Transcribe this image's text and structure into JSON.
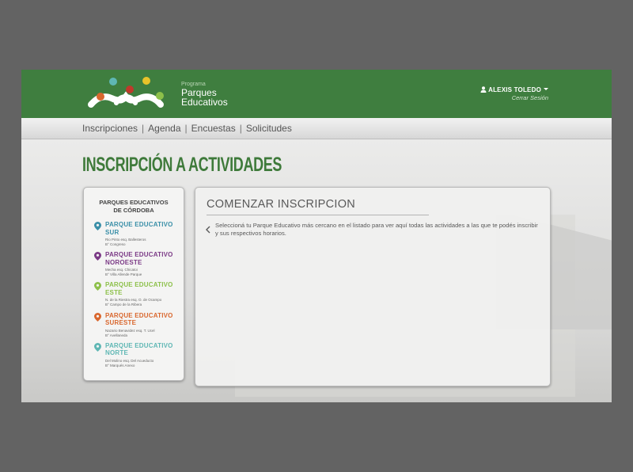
{
  "brand": {
    "small": "Programa",
    "line1": "Parques",
    "line2": "Educativos"
  },
  "user": {
    "name": "ALEXIS TOLEDO",
    "logout": "Cerrar Sesión"
  },
  "nav": {
    "items": [
      "Inscripciones",
      "Agenda",
      "Encuestas",
      "Solicitudes"
    ],
    "separator": "|"
  },
  "page_title": "INSCRIPCIÓN A ACTIVIDADES",
  "sidebar": {
    "title_line1": "PARQUES EDUCATIVOS",
    "title_line2": "DE CÓRDOBA",
    "parks": [
      {
        "name1": "PARQUE EDUCATIVO",
        "name2": "SUR",
        "addr1": "Rio Pinto esq. Ballesteros",
        "addr2": "B° Congreso",
        "color": "#3a8fa8"
      },
      {
        "name1": "PARQUE EDUCATIVO",
        "name2": "NOROESTE",
        "addr1": "Mecha esq. Chicatoi",
        "addr2": "B° Villa Allende Parque",
        "color": "#7b3a86"
      },
      {
        "name1": "PARQUE EDUCATIVO",
        "name2": "ESTE",
        "addr1": "N. de la Riestra esq. O. de Ocampo",
        "addr2": "B° Campo de la Ribera",
        "color": "#8dc04a"
      },
      {
        "name1": "PARQUE EDUCATIVO",
        "name2": "SURESTE",
        "addr1": "Nazario Benavidez esq. T. Ucel",
        "addr2": "B° Avellaneda",
        "color": "#d9672e"
      },
      {
        "name1": "PARQUE EDUCATIVO",
        "name2": "NORTE",
        "addr1": "Del Molino esq. Del Acueducto",
        "addr2": "B° Marqués Anexo",
        "color": "#5fb7b4"
      }
    ]
  },
  "panel": {
    "title": "COMENZAR INSCRIPCION",
    "text": "Seleccioná tu Parque Educativo más cercano en el listado para ver aquí todas las actividades a las que te podés inscribir y sus respectivos horarios."
  },
  "colors": {
    "header": "#3f7e3f",
    "title": "#3e7a3a"
  }
}
